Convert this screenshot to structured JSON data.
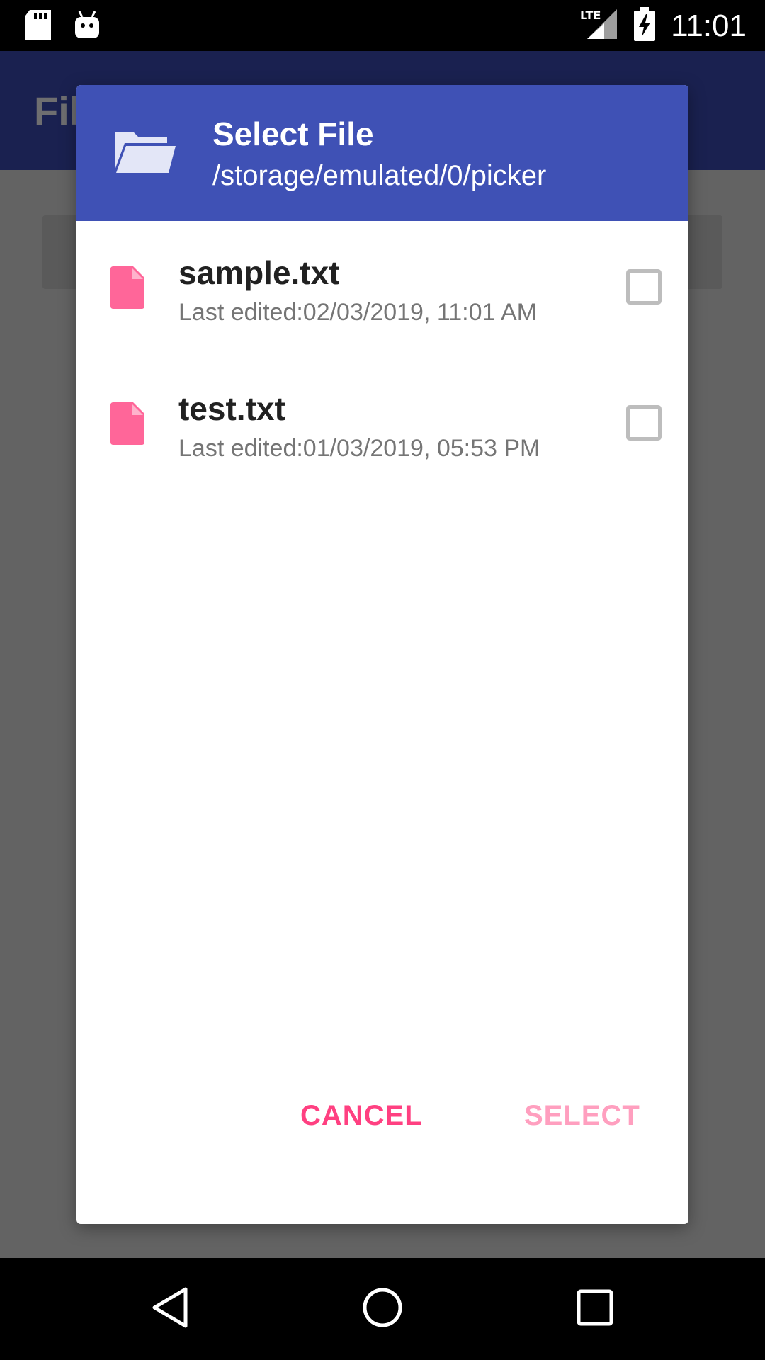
{
  "status_bar": {
    "time": "11:01",
    "network_label": "LTE",
    "icons": [
      "sd-card-icon",
      "android-icon",
      "signal-icon",
      "battery-charging-icon"
    ]
  },
  "app": {
    "title": "File"
  },
  "dialog": {
    "title": "Select File",
    "path": "/storage/emulated/0/picker",
    "header_icon": "folder-open-icon",
    "files": [
      {
        "name": "sample.txt",
        "meta": "Last edited:02/03/2019, 11:01 AM",
        "checked": false
      },
      {
        "name": "test.txt",
        "meta": "Last edited:01/03/2019, 05:53 PM",
        "checked": false
      }
    ],
    "cancel_label": "CANCEL",
    "select_label": "SELECT"
  },
  "colors": {
    "header": "#3f51b5",
    "accent": "#ff4081",
    "accent_disabled": "#ff9fbf",
    "file_icon": "#ff6699"
  },
  "nav_bar": {
    "icons": [
      "back-icon",
      "home-icon",
      "recent-apps-icon"
    ]
  }
}
